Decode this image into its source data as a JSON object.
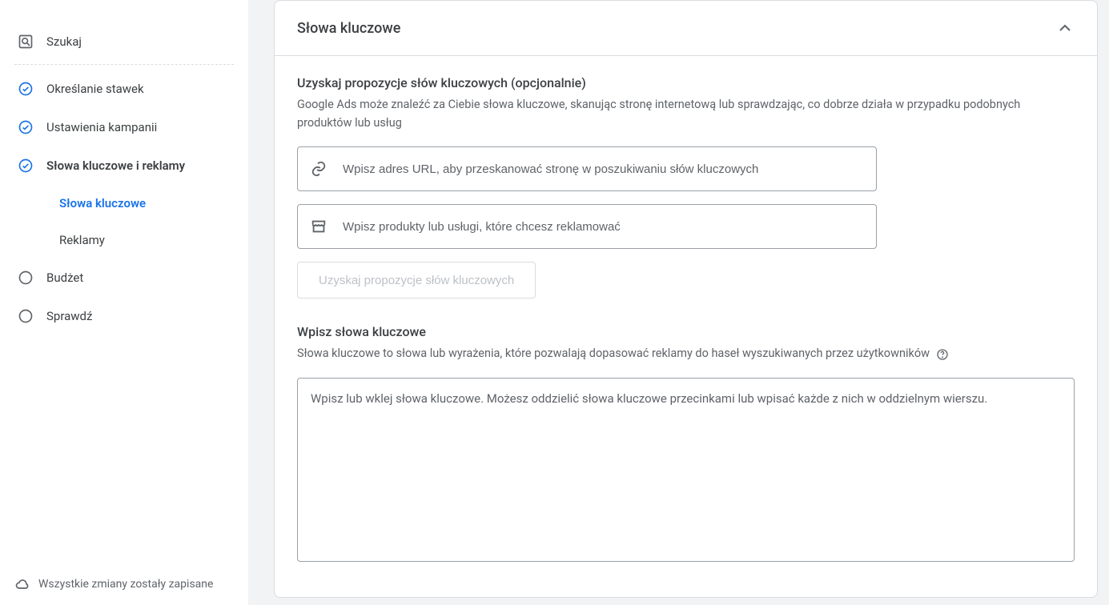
{
  "sidebar": {
    "search_label": "Szukaj",
    "items": [
      {
        "key": "bidding",
        "label": "Określanie stawek",
        "icon": "check-circle",
        "done": true,
        "bold": false
      },
      {
        "key": "campaign",
        "label": "Ustawienia kampanii",
        "icon": "check-circle",
        "done": true,
        "bold": false
      },
      {
        "key": "keywords",
        "label": "Słowa kluczowe i reklamy",
        "icon": "check-circle",
        "done": true,
        "bold": true
      },
      {
        "key": "budget",
        "label": "Budżet",
        "icon": "radio-empty",
        "done": false,
        "bold": false
      },
      {
        "key": "review",
        "label": "Sprawdź",
        "icon": "radio-empty",
        "done": false,
        "bold": false
      }
    ],
    "subitems": [
      {
        "key": "kw",
        "label": "Słowa kluczowe",
        "active": true
      },
      {
        "key": "ads",
        "label": "Reklamy",
        "active": false
      }
    ],
    "footer_label": "Wszystkie zmiany zostały zapisane"
  },
  "card": {
    "title": "Słowa kluczowe",
    "suggest": {
      "title": "Uzyskaj propozycje słów kluczowych (opcjonalnie)",
      "desc": "Google Ads może znaleźć za Ciebie słowa kluczowe, skanując stronę internetową lub sprawdzając, co dobrze działa w przypadku podobnych produktów lub usług",
      "url_placeholder": "Wpisz adres URL, aby przeskanować stronę w poszukiwaniu słów kluczowych",
      "products_placeholder": "Wpisz produkty lub usługi, które chcesz reklamować",
      "button_label": "Uzyskaj propozycje słów kluczowych"
    },
    "enter_kw": {
      "title": "Wpisz słowa kluczowe",
      "desc": "Słowa kluczowe to słowa lub wyrażenia, które pozwalają dopasować reklamy do haseł wyszukiwanych przez użytkowników",
      "textarea_placeholder": "Wpisz lub wklej słowa kluczowe. Możesz oddzielić słowa kluczowe przecinkami lub wpisać każde z nich w oddzielnym wierszu."
    }
  }
}
